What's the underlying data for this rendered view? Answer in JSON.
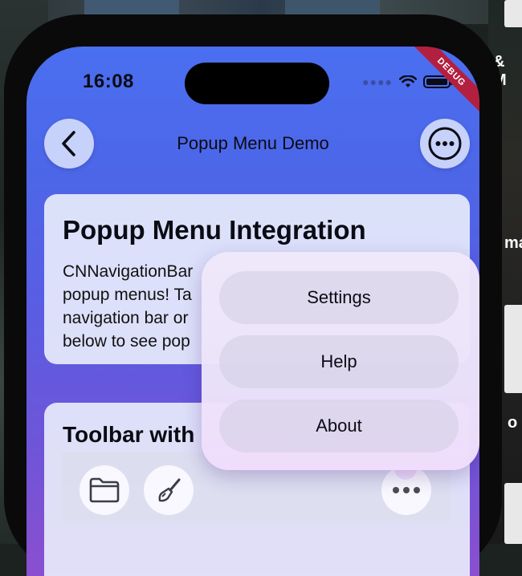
{
  "status_bar": {
    "time": "16:08"
  },
  "debug_banner": "DEBUG",
  "nav": {
    "title": "Popup Menu Demo",
    "back_icon": "chevron-left-icon",
    "more_icon": "ellipsis-circle-icon"
  },
  "card1": {
    "title": "Popup Menu Integration",
    "body_lines": [
      "CNNavigationBar",
      "popup menus! Ta",
      "navigation bar or",
      "below to see pop"
    ]
  },
  "card2": {
    "title": "Toolbar with",
    "tools": [
      {
        "icon": "folder-icon"
      },
      {
        "icon": "paintbrush-icon"
      },
      {
        "icon": "ellipsis-icon"
      }
    ]
  },
  "popup_menu": {
    "items": [
      {
        "label": "Settings"
      },
      {
        "label": "Help"
      },
      {
        "label": "About"
      }
    ]
  },
  "background": {
    "side_texts": [
      "& M",
      "ma",
      "o"
    ]
  },
  "colors": {
    "gradient_top": "#4a6ff0",
    "gradient_bottom": "#8a4fcf",
    "debug_ribbon": "#b3203f"
  }
}
